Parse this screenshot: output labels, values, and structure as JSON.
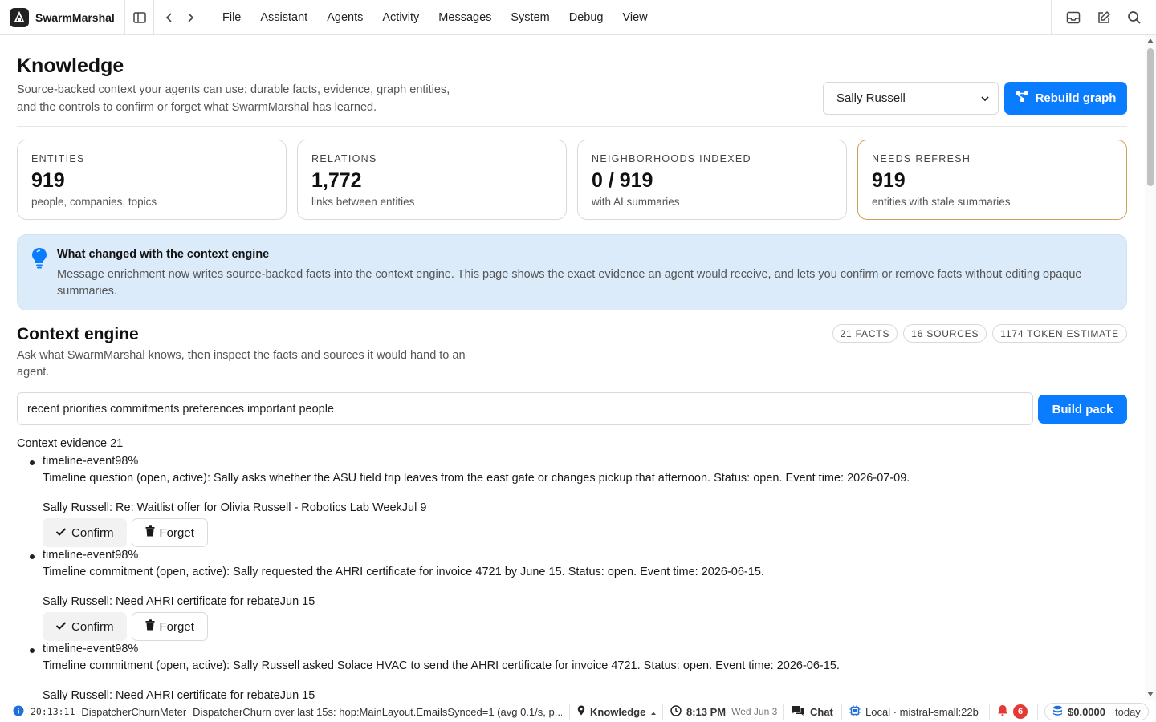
{
  "app": {
    "name": "SwarmMarshal"
  },
  "menu": [
    "File",
    "Assistant",
    "Agents",
    "Activity",
    "Messages",
    "System",
    "Debug",
    "View"
  ],
  "header": {
    "title": "Knowledge",
    "subtitle": "Source-backed context your agents can use: durable facts, evidence, graph entities, and the controls to confirm or forget what SwarmMarshal has learned.",
    "person_select": "Sally Russell",
    "rebuild_label": "Rebuild graph"
  },
  "stats": [
    {
      "label": "ENTITIES",
      "value": "919",
      "desc": "people, companies, topics"
    },
    {
      "label": "RELATIONS",
      "value": "1,772",
      "desc": "links between entities"
    },
    {
      "label": "NEIGHBORHOODS INDEXED",
      "value": "0 / 919",
      "desc": "with AI summaries"
    },
    {
      "label": "NEEDS REFRESH",
      "value": "919",
      "desc": "entities with stale summaries"
    }
  ],
  "notice": {
    "title": "What changed with the context engine",
    "body": "Message enrichment now writes source-backed facts into the context engine. This page shows the exact evidence an agent would receive, and lets you confirm or remove facts without editing opaque summaries."
  },
  "context": {
    "title": "Context engine",
    "subtitle": "Ask what SwarmMarshal knows, then inspect the facts and sources it would hand to an agent.",
    "chips": [
      "21 FACTS",
      "16 SOURCES",
      "1174 TOKEN ESTIMATE"
    ],
    "query": "recent priorities commitments preferences important people",
    "build_label": "Build pack",
    "evidence_header": "Context evidence 21",
    "confirm_label": "Confirm",
    "forget_label": "Forget",
    "items": [
      {
        "kind": "timeline-event98%",
        "text": "Timeline question (open, active): Sally asks whether the ASU field trip leaves from the east gate or changes pickup that afternoon. Status: open. Event time: 2026-07-09.",
        "source": "Sally Russell: Re: Waitlist offer for Olivia Russell - Robotics Lab WeekJul 9"
      },
      {
        "kind": "timeline-event98%",
        "text": "Timeline commitment (open, active): Sally requested the AHRI certificate for invoice 4721 by June 15. Status: open. Event time: 2026-06-15.",
        "source": "Sally Russell: Need AHRI certificate for rebateJun 15"
      },
      {
        "kind": "timeline-event98%",
        "text": "Timeline commitment (open, active): Sally Russell asked Solace HVAC to send the AHRI certificate for invoice 4721. Status: open. Event time: 2026-06-15.",
        "source": "Sally Russell: Need AHRI certificate for rebateJun 15"
      }
    ]
  },
  "status": {
    "time": "20:13:11",
    "meter": "DispatcherChurnMeter",
    "message": "DispatcherChurn over last 15s: hop:MainLayout.EmailsSynced=1 (avg 0.1/s, p...",
    "location": "Knowledge",
    "clock": "8:13 PM",
    "date": "Wed Jun 3",
    "chat": "Chat",
    "model": "Local · mistral-small:22b",
    "notifications": "6",
    "cost": "$0.0000",
    "cost_period": "today"
  },
  "colors": {
    "accent": "#0a7cff",
    "notice_bg": "#dcebfa",
    "highlight_border": "#c9a257",
    "badge": "#e53935"
  }
}
